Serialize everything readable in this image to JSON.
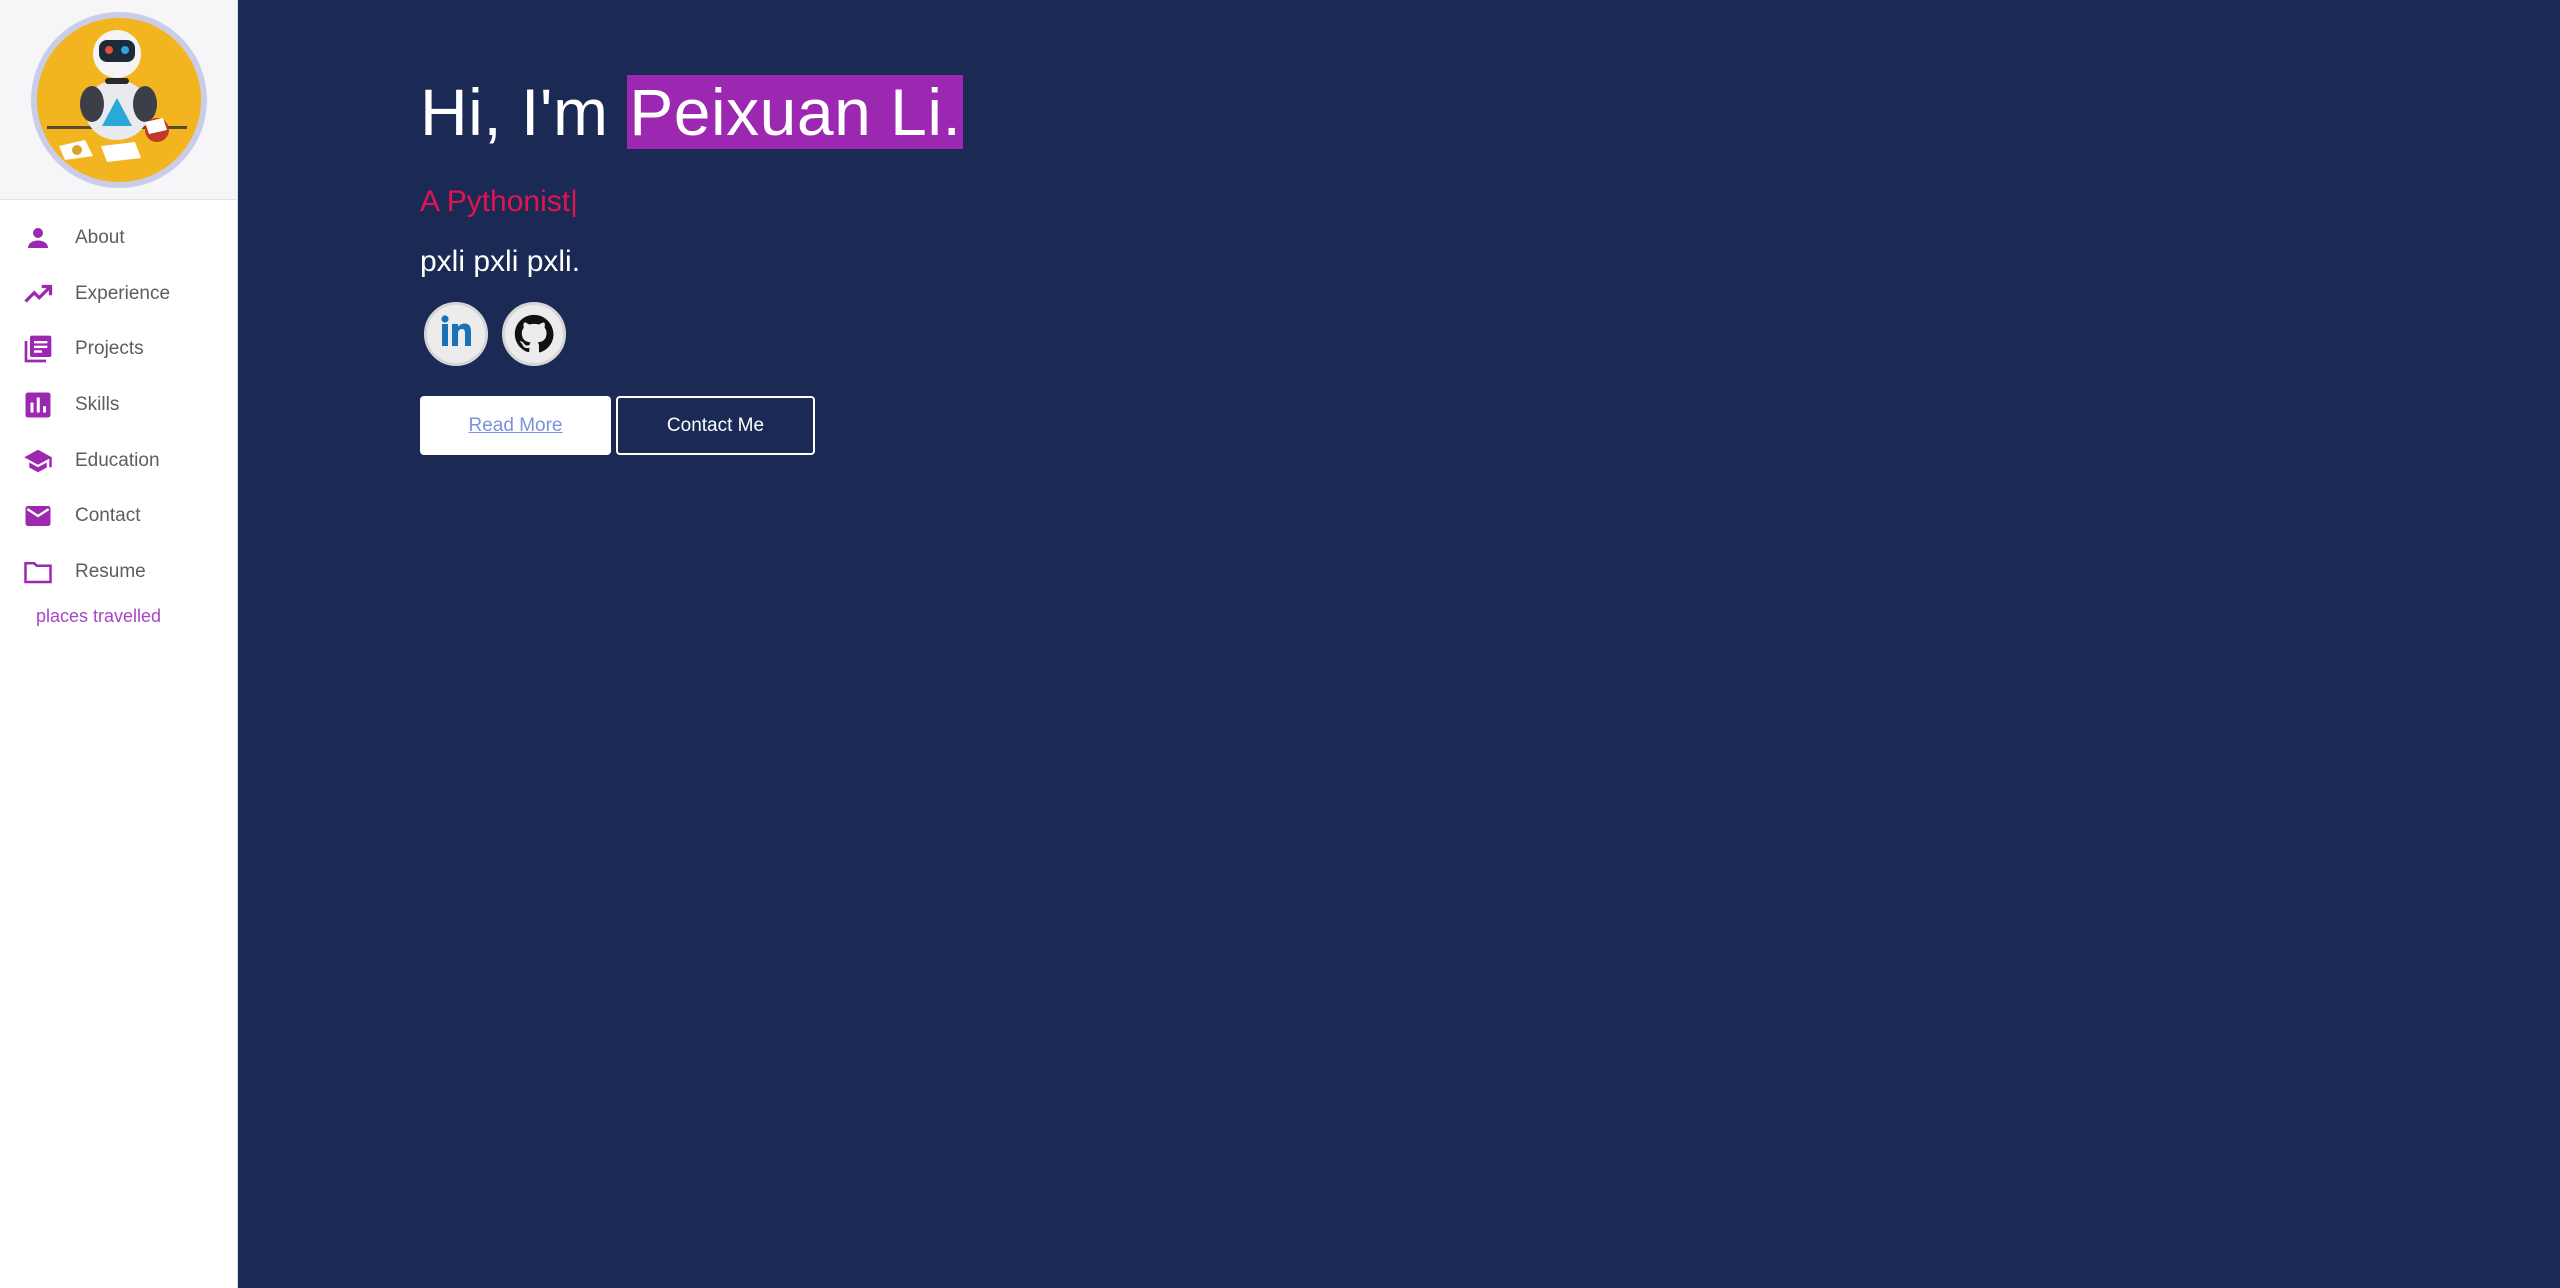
{
  "sidebar": {
    "avatar": {
      "icon": "robot-avatar",
      "background": "#f2b51f"
    },
    "items": [
      {
        "label": "About",
        "icon": "person-icon"
      },
      {
        "label": "Experience",
        "icon": "trending-up-icon"
      },
      {
        "label": "Projects",
        "icon": "library-books-icon"
      },
      {
        "label": "Skills",
        "icon": "bar-chart-icon"
      },
      {
        "label": "Education",
        "icon": "school-icon"
      },
      {
        "label": "Contact",
        "icon": "mail-icon"
      },
      {
        "label": "Resume",
        "icon": "folder-icon"
      }
    ],
    "places_link": "places travelled",
    "accent": "#9c27b0"
  },
  "hero": {
    "greeting": "Hi, I'm ",
    "name": "Peixuan Li.",
    "tagline": "A Pythonist|",
    "subtext": "pxli pxli pxli.",
    "socials": [
      {
        "name": "LinkedIn",
        "icon": "linkedin-icon"
      },
      {
        "name": "GitHub",
        "icon": "github-icon"
      }
    ],
    "read_more": "Read More",
    "contact_me": "Contact Me"
  },
  "colors": {
    "background": "#1b2a55",
    "highlight": "#9c27b0",
    "tagline": "#e0144f"
  }
}
